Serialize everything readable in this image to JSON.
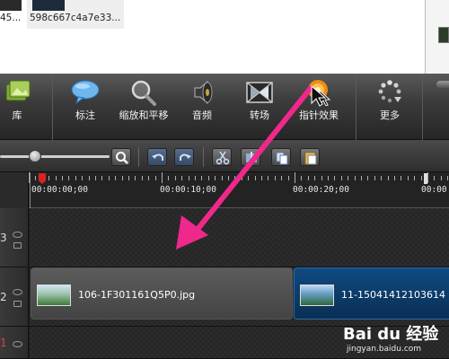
{
  "media_bin": {
    "item1_label": "45...",
    "item2_label": "598c667c4a7e33..."
  },
  "toolbar": {
    "items": [
      {
        "label": "库",
        "icon": "library-icon"
      },
      {
        "label": "标注",
        "icon": "callout-bubble-icon"
      },
      {
        "label": "缩放和平移",
        "icon": "zoom-magnifier-icon"
      },
      {
        "label": "音频",
        "icon": "speaker-icon"
      },
      {
        "label": "转场",
        "icon": "transition-icon"
      },
      {
        "label": "指针效果",
        "icon": "cursor-effect-icon"
      },
      {
        "label": "更多",
        "icon": "more-dots-icon"
      }
    ]
  },
  "timeline": {
    "timecodes": [
      "00:00:00;00",
      "00:00:10;00",
      "00:00:20;00",
      "00:00"
    ],
    "tracks": [
      {
        "number": "3"
      },
      {
        "number": "2"
      },
      {
        "number": "1"
      }
    ],
    "clips": [
      {
        "name": "106-1F301161Q5P0.jpg"
      },
      {
        "name": "11-15041412103614"
      }
    ]
  },
  "colors": {
    "arrow": "#f0288c",
    "cursor_effect_icon": "#f08a18",
    "clip_selected": "#0f4a80"
  },
  "watermark": {
    "logo": "Bai du 经验",
    "url": "jingyan.baidu.com"
  }
}
